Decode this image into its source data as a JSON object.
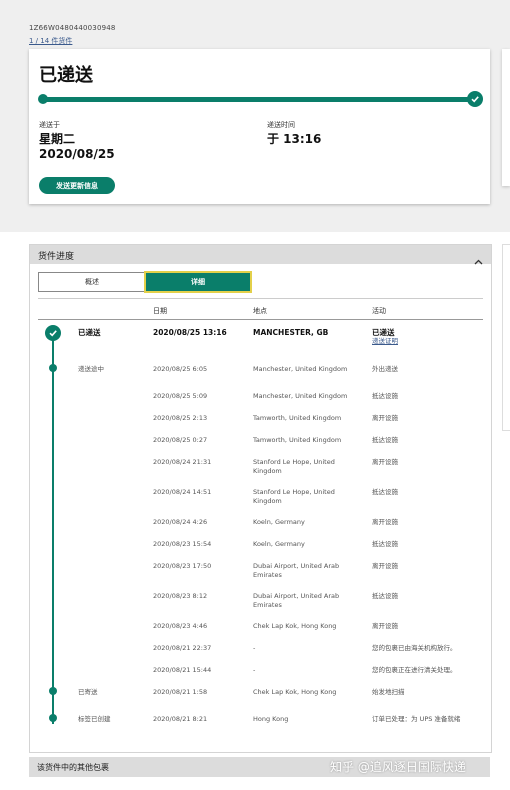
{
  "header": {
    "tracking_number": "1Z66W0480440030948",
    "package_count": "1 / 14 件货件"
  },
  "summary": {
    "status": "已递送",
    "delivered_on_label": "递送于",
    "delivered_day": "星期二",
    "delivered_date": "2020/08/25",
    "delivered_time_label": "递送时间",
    "delivered_time": "于 13:16",
    "notify_button": "发送更新信息",
    "progress_percent": 100,
    "accent_color": "#0a7e6a"
  },
  "progress_section": {
    "title": "货件进度",
    "tabs": [
      "概述",
      "详细"
    ],
    "active_tab": "详细",
    "columns": {
      "date": "日期",
      "location": "地点",
      "activity": "活动"
    },
    "rows": [
      {
        "status": "已递送",
        "date": "2020/08/25  13:16",
        "location": "MANCHESTER, GB",
        "activity": "已递送",
        "activity_link": "递送证明"
      },
      {
        "status": "递送途中",
        "date": "2020/08/25  6:05",
        "location": "Manchester, United Kingdom",
        "activity": "外出递送"
      },
      {
        "status": "",
        "date": "2020/08/25  5:09",
        "location": "Manchester, United Kingdom",
        "activity": "抵达设施"
      },
      {
        "status": "",
        "date": "2020/08/25  2:13",
        "location": "Tamworth, United Kingdom",
        "activity": "离开设施"
      },
      {
        "status": "",
        "date": "2020/08/25  0:27",
        "location": "Tamworth, United Kingdom",
        "activity": "抵达设施"
      },
      {
        "status": "",
        "date": "2020/08/24  21:31",
        "location": "Stanford Le Hope, United Kingdom",
        "activity": "离开设施"
      },
      {
        "status": "",
        "date": "2020/08/24  14:51",
        "location": "Stanford Le Hope, United Kingdom",
        "activity": "抵达设施"
      },
      {
        "status": "",
        "date": "2020/08/24  4:26",
        "location": "Koeln, Germany",
        "activity": "离开设施"
      },
      {
        "status": "",
        "date": "2020/08/23  15:54",
        "location": "Koeln, Germany",
        "activity": "抵达设施"
      },
      {
        "status": "",
        "date": "2020/08/23  17:50",
        "location": "Dubai Airport, United Arab Emirates",
        "activity": "离开设施"
      },
      {
        "status": "",
        "date": "2020/08/23  8:12",
        "location": "Dubai Airport, United Arab Emirates",
        "activity": "抵达设施"
      },
      {
        "status": "",
        "date": "2020/08/23  4:46",
        "location": "Chek Lap Kok, Hong Kong",
        "activity": "离开设施"
      },
      {
        "status": "",
        "date": "2020/08/21  22:37",
        "location": "-",
        "activity": "您的包裹已由海关机构放行。"
      },
      {
        "status": "",
        "date": "2020/08/21  15:44",
        "location": "-",
        "activity": "您的包裹正在进行清关处理。"
      },
      {
        "status": "已寄送",
        "date": "2020/08/21  1:58",
        "location": "Chek Lap Kok, Hong Kong",
        "activity": "始发地扫描"
      },
      {
        "status": "标签已创建",
        "date": "2020/08/21  8:21",
        "location": "Hong Kong",
        "activity": "订单已处理：为 UPS 准备就绪"
      }
    ]
  },
  "other_packages": {
    "title": "该货件中的其他包裹"
  },
  "watermark": "知乎 @追风逐日国际快递"
}
